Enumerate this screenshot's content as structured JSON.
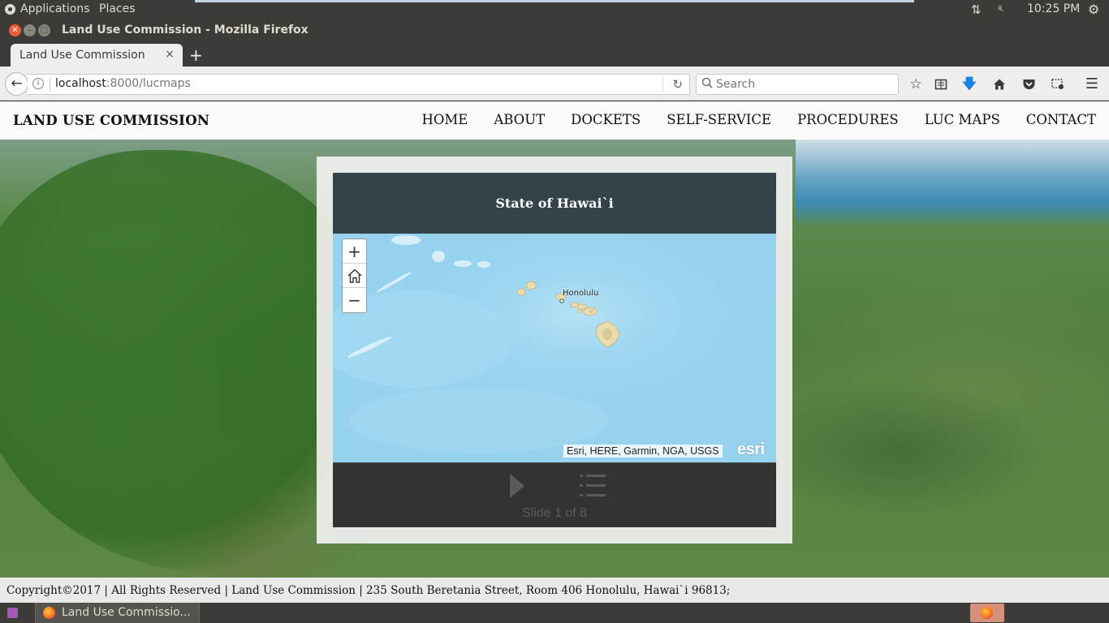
{
  "top_panel": {
    "applications_label": "Applications",
    "places_label": "Places",
    "clock": "10:25 PM"
  },
  "window": {
    "title": "Land Use Commission - Mozilla Firefox"
  },
  "tab": {
    "label": "Land Use Commission",
    "close_glyph": "×",
    "new_tab_glyph": "+"
  },
  "navbar": {
    "url_host": "localhost",
    "url_rest": ":8000/lucmaps",
    "search_placeholder": "Search"
  },
  "site": {
    "brand": "LAND USE COMMISSION",
    "nav": [
      "HOME",
      "ABOUT",
      "DOCKETS",
      "SELF-SERVICE",
      "PROCEDURES",
      "LUC MAPS",
      "CONTACT"
    ]
  },
  "story": {
    "title": "State of Hawai`i",
    "map_label": "Honolulu",
    "attribution": "Esri, HERE, Garmin, NGA, USGS",
    "logo_text": "esri",
    "zoom_in": "+",
    "zoom_out": "−",
    "slide_count": "Slide 1 of 8"
  },
  "footer": {
    "text": "Copyright©2017 | All Rights Reserved | Land Use Commission | 235 South Beretania Street, Room 406 Honolulu, Hawai`i 96813;"
  },
  "taskbar": {
    "task_label": "Land Use Commissio..."
  },
  "icons": {
    "back": "back-arrow-icon",
    "info": "info-icon",
    "reload": "reload-icon",
    "bookmark": "star-icon",
    "reader": "reading-list-icon",
    "download": "download-icon",
    "home": "home-icon",
    "pocket": "pocket-icon",
    "screenshot": "screenshot-icon",
    "menu": "hamburger-menu-icon"
  },
  "colors": {
    "story_title_bar": "#334349",
    "map_ocean": "#97d3ef",
    "controls_bg": "#333333",
    "download_arrow": "#1a82e2"
  }
}
